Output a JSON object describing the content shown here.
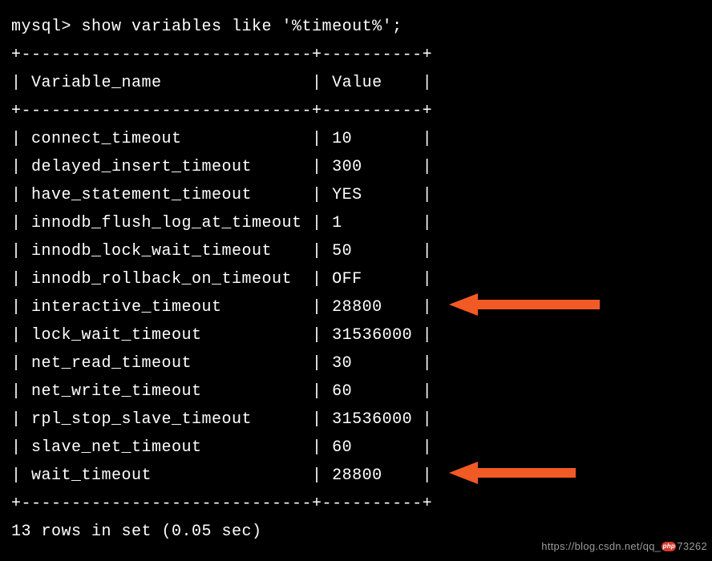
{
  "prompt": "mysql> show variables like '%timeout%';",
  "border_top": "+-----------------------------+----------+",
  "header_line": "| Variable_name               | Value    |",
  "border_mid": "+-----------------------------+----------+",
  "rows": [
    {
      "name": "connect_timeout",
      "value": "10"
    },
    {
      "name": "delayed_insert_timeout",
      "value": "300"
    },
    {
      "name": "have_statement_timeout",
      "value": "YES"
    },
    {
      "name": "innodb_flush_log_at_timeout",
      "value": "1"
    },
    {
      "name": "innodb_lock_wait_timeout",
      "value": "50"
    },
    {
      "name": "innodb_rollback_on_timeout",
      "value": "OFF"
    },
    {
      "name": "interactive_timeout",
      "value": "28800"
    },
    {
      "name": "lock_wait_timeout",
      "value": "31536000"
    },
    {
      "name": "net_read_timeout",
      "value": "30"
    },
    {
      "name": "net_write_timeout",
      "value": "60"
    },
    {
      "name": "rpl_stop_slave_timeout",
      "value": "31536000"
    },
    {
      "name": "slave_net_timeout",
      "value": "60"
    },
    {
      "name": "wait_timeout",
      "value": "28800"
    }
  ],
  "border_bot": "+-----------------------------+----------+",
  "footer": "13 rows in set (0.05 sec)",
  "col1_width": 27,
  "col2_width": 8,
  "watermark": {
    "prefix": "https://blog.csdn.net/qq_",
    "badge": "php",
    "suffix": "73262"
  },
  "chart_data": {
    "type": "table",
    "title": "show variables like '%timeout%'",
    "columns": [
      "Variable_name",
      "Value"
    ],
    "rows": [
      [
        "connect_timeout",
        "10"
      ],
      [
        "delayed_insert_timeout",
        "300"
      ],
      [
        "have_statement_timeout",
        "YES"
      ],
      [
        "innodb_flush_log_at_timeout",
        "1"
      ],
      [
        "innodb_lock_wait_timeout",
        "50"
      ],
      [
        "innodb_rollback_on_timeout",
        "OFF"
      ],
      [
        "interactive_timeout",
        "28800"
      ],
      [
        "lock_wait_timeout",
        "31536000"
      ],
      [
        "net_read_timeout",
        "30"
      ],
      [
        "net_write_timeout",
        "60"
      ],
      [
        "rpl_stop_slave_timeout",
        "31536000"
      ],
      [
        "slave_net_timeout",
        "60"
      ],
      [
        "wait_timeout",
        "28800"
      ]
    ],
    "highlighted_rows": [
      "interactive_timeout",
      "wait_timeout"
    ]
  }
}
